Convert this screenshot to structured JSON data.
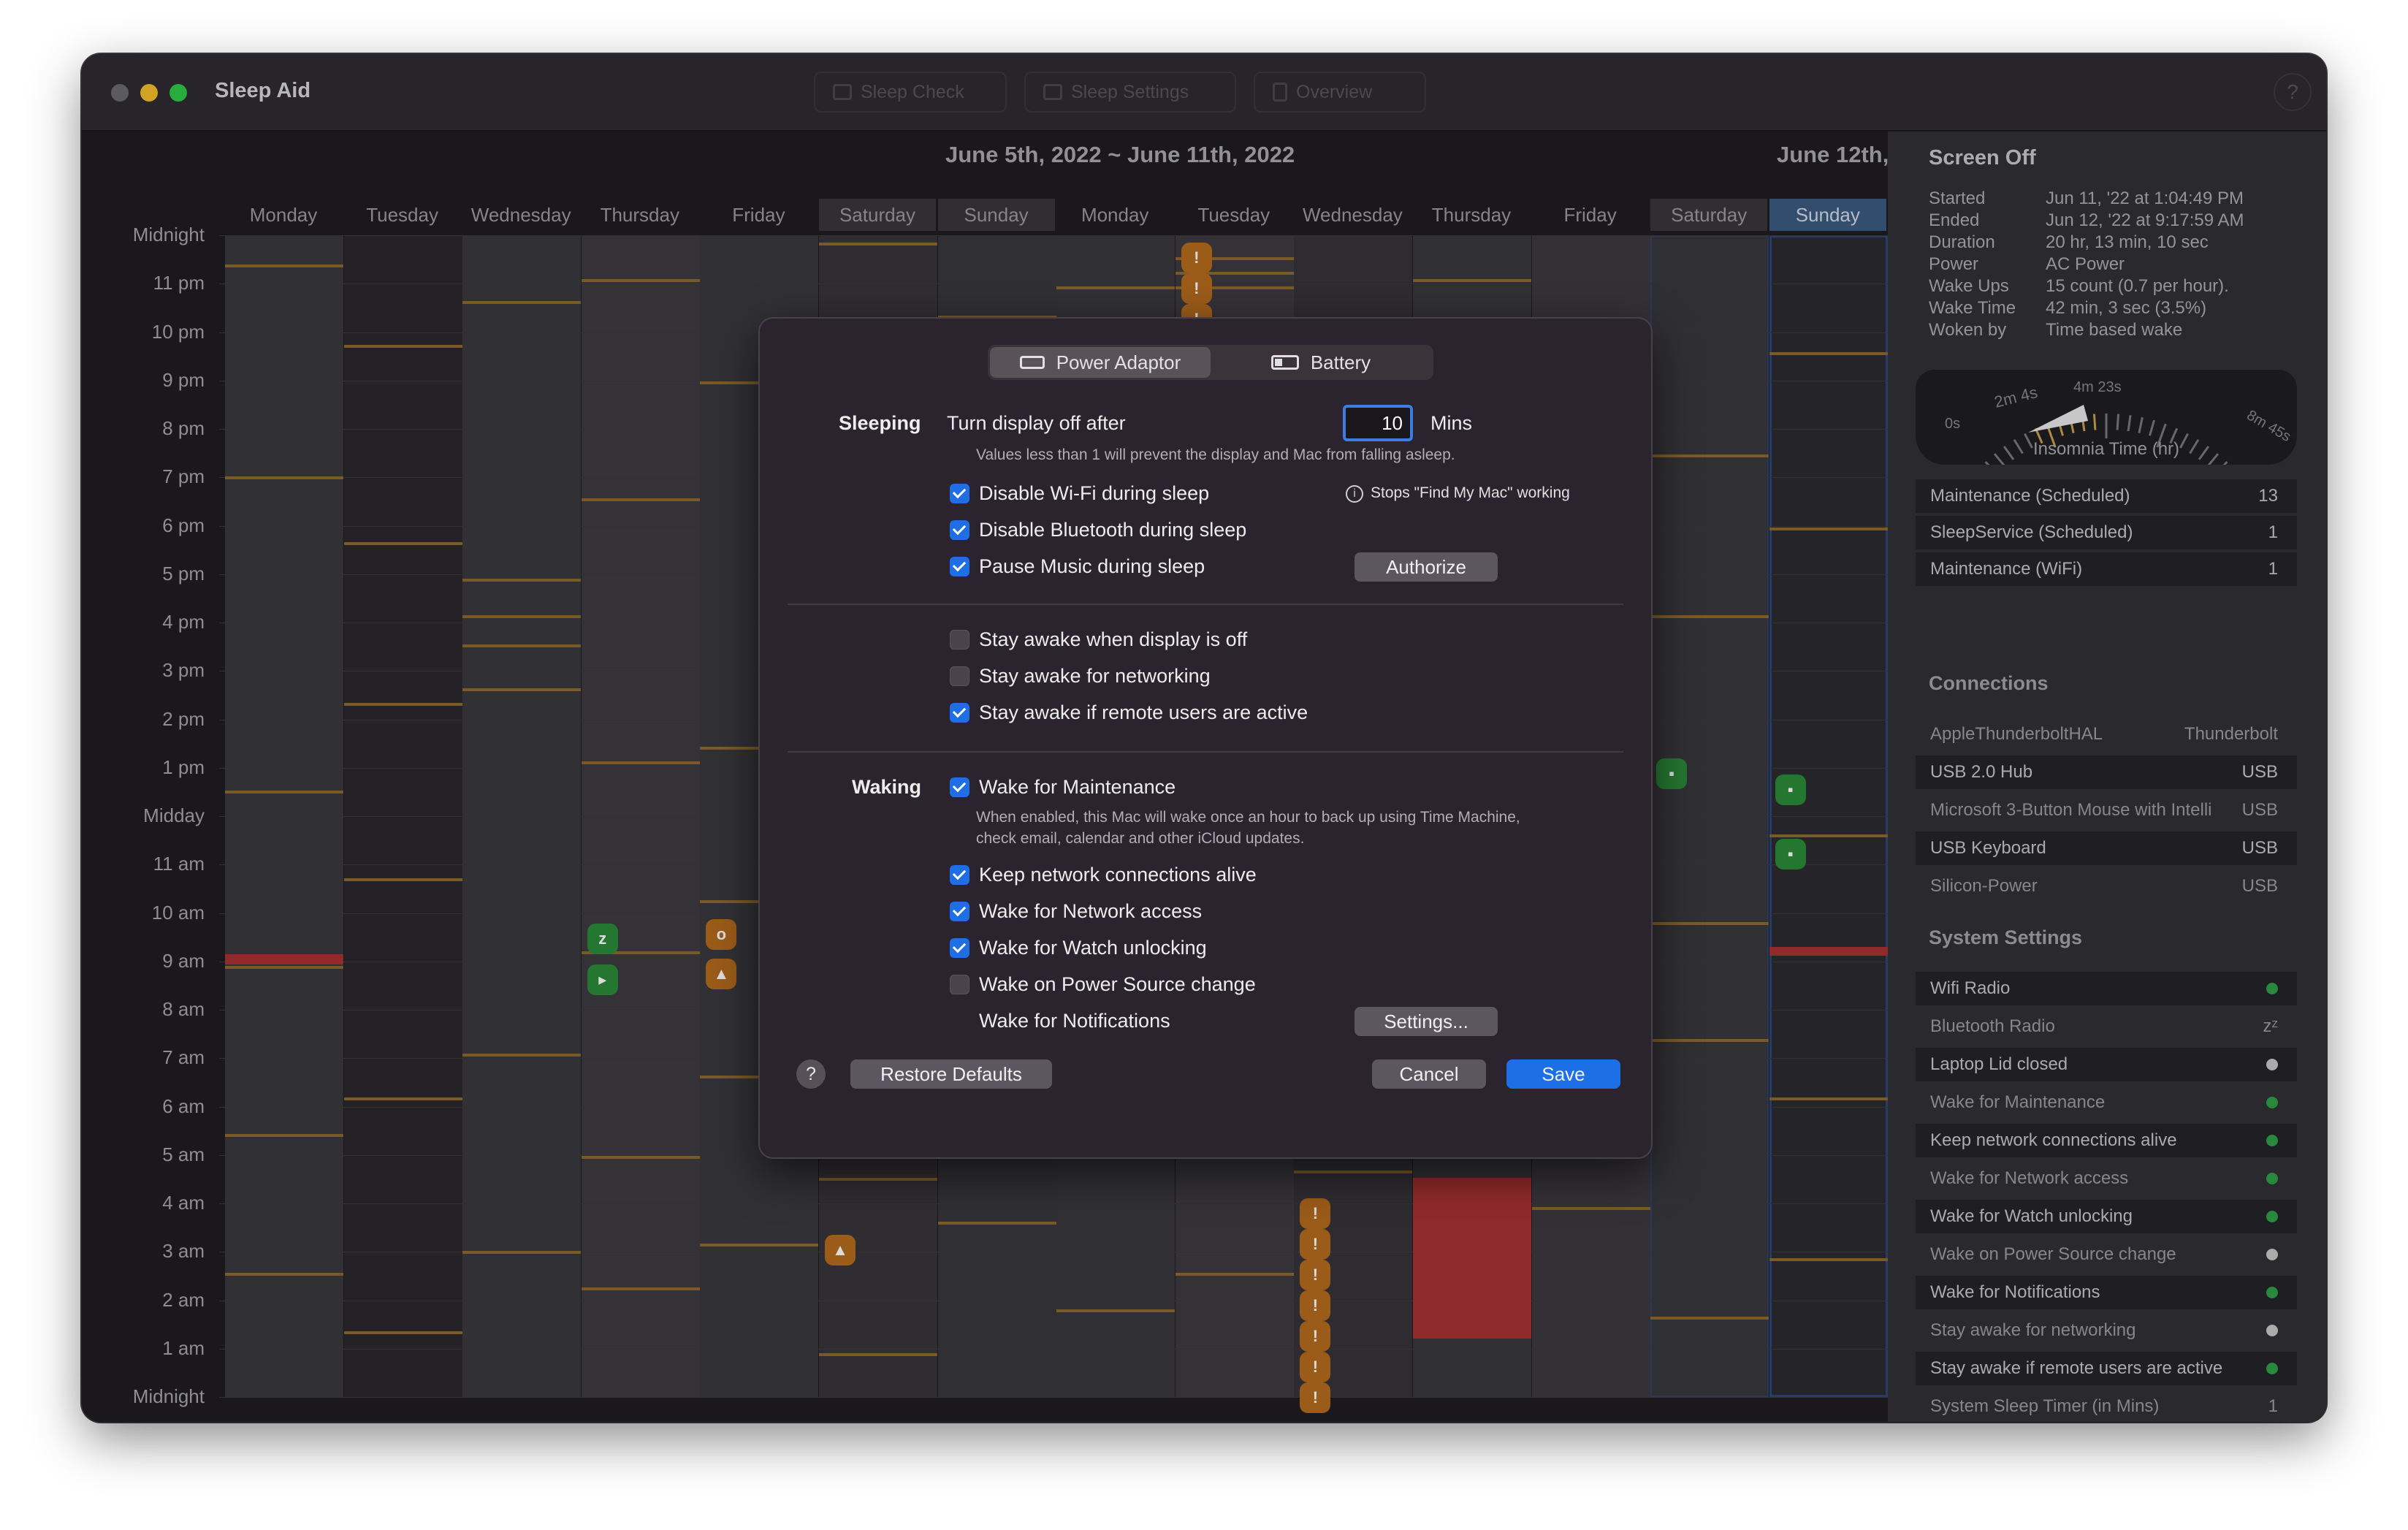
{
  "window": {
    "title": "Sleep Aid"
  },
  "toolbar": {
    "sleep_check": "Sleep Check",
    "sleep_settings": "Sleep Settings",
    "overview": "Overview",
    "help": "?"
  },
  "calendar": {
    "week_title": "June 5th, 2022 ~ June 11th, 2022",
    "next_week_title": "June 12th,",
    "days": [
      "Monday",
      "Tuesday",
      "Wednesday",
      "Thursday",
      "Friday",
      "Saturday",
      "Sunday",
      "Monday",
      "Tuesday",
      "Wednesday",
      "Thursday",
      "Friday",
      "Saturday",
      "Sunday"
    ],
    "hours": [
      "Midnight",
      "11 pm",
      "10 pm",
      "9 pm",
      "8 pm",
      "7 pm",
      "6 pm",
      "5 pm",
      "4 pm",
      "3 pm",
      "2 pm",
      "1 pm",
      "Midday",
      "11 am",
      "10 am",
      "9 am",
      "8 am",
      "7 am",
      "6 am",
      "5 am",
      "4 am",
      "3 am",
      "2 am",
      "1 am",
      "Midnight"
    ]
  },
  "sidebar": {
    "title": "Screen Off",
    "info": [
      {
        "label": "Started",
        "value": "Jun 11, '22 at 1:04:49 PM"
      },
      {
        "label": "Ended",
        "value": "Jun 12, '22 at 9:17:59 AM"
      },
      {
        "label": "Duration",
        "value": "20 hr, 13 min, 10 sec"
      },
      {
        "label": "Power",
        "value": "AC Power"
      },
      {
        "label": "Wake Ups",
        "value": "15 count (0.7 per hour)."
      },
      {
        "label": "Wake Time",
        "value": "42 min, 3 sec (3.5%)"
      },
      {
        "label": "Woken by",
        "value": "Time based wake"
      }
    ],
    "gauge": {
      "label": "Insomnia Time (hr)",
      "ticks": [
        "0s",
        "2m 4s",
        "4m 23s",
        "8m 45s"
      ]
    },
    "wake_reasons": [
      {
        "label": "Maintenance (Scheduled)",
        "value": "13"
      },
      {
        "label": "SleepService (Scheduled)",
        "value": "1"
      },
      {
        "label": "Maintenance (WiFi)",
        "value": "1"
      }
    ],
    "connections_title": "Connections",
    "connections": [
      {
        "label": "AppleThunderboltHAL",
        "value": "Thunderbolt"
      },
      {
        "label": "USB 2.0 Hub",
        "value": "USB"
      },
      {
        "label": "Microsoft 3-Button Mouse with Intelli",
        "value": "USB"
      },
      {
        "label": "USB Keyboard",
        "value": "USB"
      },
      {
        "label": "Silicon-Power",
        "value": "USB"
      }
    ],
    "system_title": "System Settings",
    "system": [
      {
        "label": "Wifi Radio",
        "status": "green"
      },
      {
        "label": "Bluetooth Radio",
        "status": "zz"
      },
      {
        "label": "Laptop Lid closed",
        "status": "white"
      },
      {
        "label": "Wake for Maintenance",
        "status": "green"
      },
      {
        "label": "Keep network connections alive",
        "status": "green"
      },
      {
        "label": "Wake for Network access",
        "status": "green"
      },
      {
        "label": "Wake for  Watch unlocking",
        "status": "green"
      },
      {
        "label": "Wake on Power Source change",
        "status": "white"
      },
      {
        "label": "Wake for Notifications",
        "status": "green"
      },
      {
        "label": "Stay awake for networking",
        "status": "white"
      },
      {
        "label": "Stay awake if remote users are active",
        "status": "green"
      },
      {
        "label": "System Sleep Timer (in Mins)",
        "value": "1"
      }
    ]
  },
  "dialog": {
    "tabs": {
      "power": "Power Adaptor",
      "battery": "Battery"
    },
    "sleeping_label": "Sleeping",
    "display_off_label": "Turn display off after",
    "display_off_value": "10",
    "display_off_unit": "Mins",
    "display_off_note": "Values less than 1 will prevent the display and Mac from falling asleep.",
    "disable_wifi": "Disable Wi-Fi during sleep",
    "wifi_note": "Stops \"Find My Mac\" working",
    "disable_bt": "Disable Bluetooth during sleep",
    "pause_music": "Pause  Music during sleep",
    "authorize": "Authorize",
    "stay_display": "Stay awake when display is off",
    "stay_network": "Stay awake for networking",
    "stay_remote": "Stay awake if remote users are active",
    "waking_label": "Waking",
    "wake_maint": "Wake for Maintenance",
    "wake_maint_note": "When enabled, this Mac will wake once an hour to back up using Time Machine, check email, calendar and other iCloud updates.",
    "keep_net": "Keep network connections alive",
    "wake_net": "Wake for Network access",
    "wake_watch": "Wake for  Watch unlocking",
    "wake_power": "Wake on Power Source change",
    "wake_notif": "Wake for Notifications",
    "settings_btn": "Settings...",
    "help": "?",
    "restore": "Restore Defaults",
    "cancel": "Cancel",
    "save": "Save"
  },
  "colors": {
    "accent": "#1d6fe6",
    "sleep_bar": "#8f6a2e",
    "alert": "#a93232",
    "green": "#2ea043",
    "selected_day": "#3c5a82"
  }
}
